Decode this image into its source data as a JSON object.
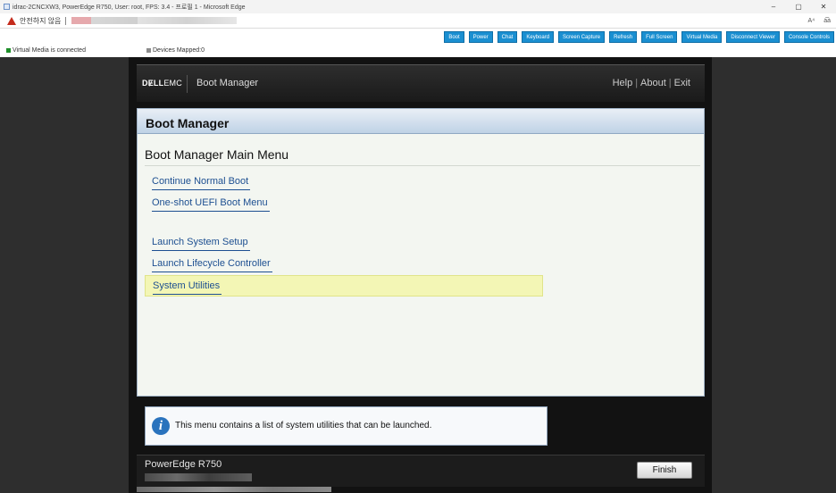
{
  "browser": {
    "window_title": "idrac-2CNCXW3, PowerEdge R750, User: root, FPS: 3.4 - 프로필 1 - Microsoft Edge",
    "security_warning": "안전하지 않음",
    "addr_icons": [
      "A⁴",
      "a͡a"
    ],
    "window_controls": [
      "–",
      "▢",
      "✕"
    ]
  },
  "idrac_toolbar": {
    "virtual_media_status": "Virtual Media is connected",
    "devices_mapped": "Devices Mapped:0",
    "buttons": [
      "Boot",
      "Power",
      "Chat",
      "Keyboard",
      "Screen Capture",
      "Refresh",
      "Full Screen",
      "Virtual Media",
      "Disconnect Viewer",
      "Console Controls"
    ],
    "button_color": "#1a8fd1"
  },
  "boot_manager": {
    "logo_dell": "DɆLL",
    "logo_emc": "EMC",
    "header_title": "Boot Manager",
    "header_links": [
      "Help",
      "About",
      "Exit"
    ],
    "panel_title": "Boot Manager",
    "menu_heading": "Boot Manager Main Menu",
    "menu_items": [
      "Continue Normal Boot",
      "One-shot UEFI Boot Menu",
      "Launch System Setup",
      "Launch Lifecycle Controller",
      "System Utilities"
    ],
    "selected_item": "System Utilities",
    "info_icon": "info-icon",
    "info_text": "This menu contains a list of system utilities that can be launched.",
    "model": "PowerEdge R750",
    "finish_label": "Finish"
  }
}
